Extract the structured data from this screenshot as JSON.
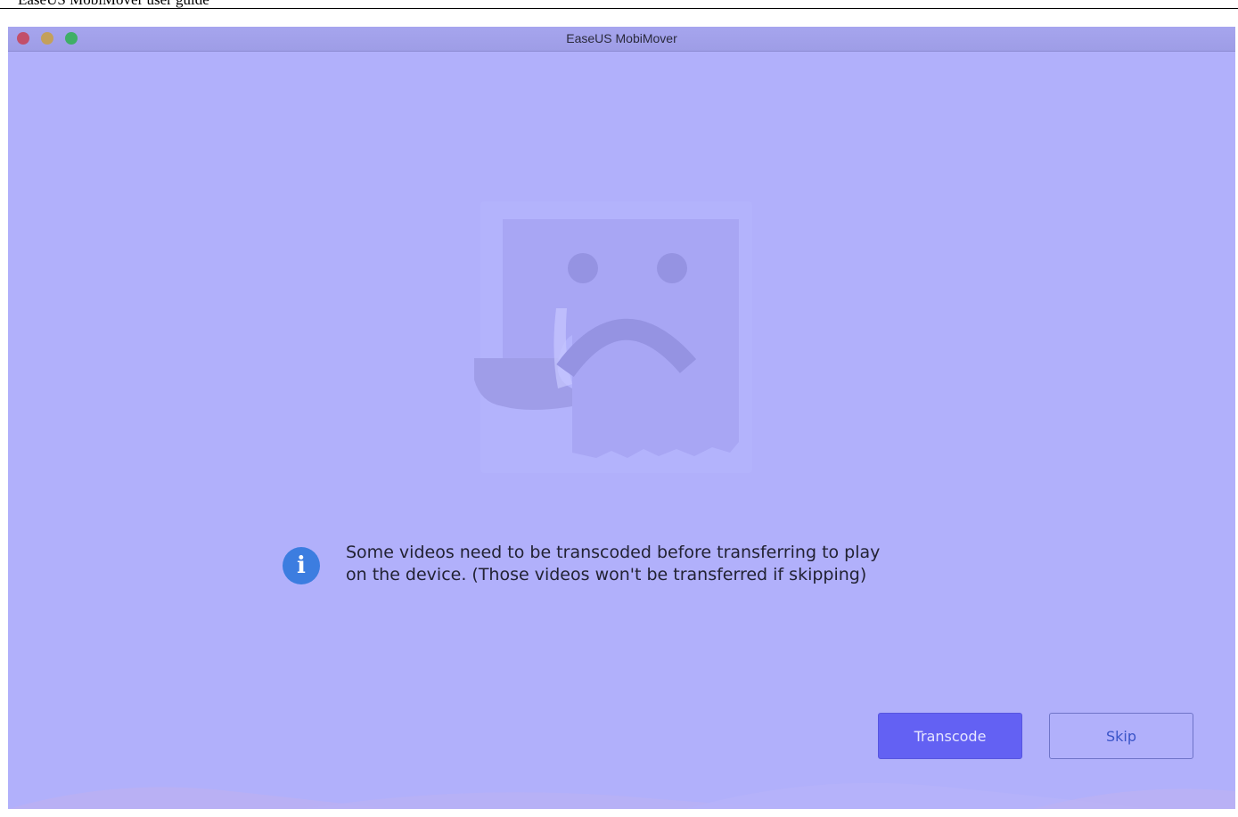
{
  "document": {
    "header_text": "EaseUS MobiMover user guide"
  },
  "window": {
    "title": "EaseUS MobiMover"
  },
  "dialog": {
    "info_icon_glyph": "i",
    "message_line1": "Some videos need to be transcoded before transferring to play",
    "message_line2": "on the device. (Those videos won't be transferred if skipping)"
  },
  "buttons": {
    "transcode_label": "Transcode",
    "skip_label": "Skip"
  },
  "colors": {
    "background": "#b1b0fb",
    "primary_button": "#6361f3",
    "info_icon": "#3c7de0"
  }
}
